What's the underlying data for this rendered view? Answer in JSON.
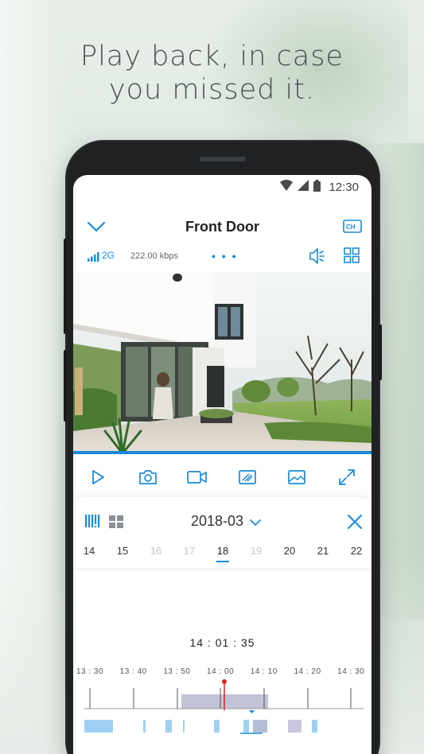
{
  "headline": {
    "line1": "Play back, in case",
    "line2": "you missed it."
  },
  "statusbar": {
    "time": "12:30",
    "icons": [
      "wifi-icon",
      "cell-signal-icon",
      "battery-icon"
    ]
  },
  "appbar": {
    "title": "Front Door",
    "back_icon": "chevron-down-icon",
    "channel_button_label": "CH"
  },
  "infobar": {
    "network": "2G",
    "bitrate": "222.00 kbps",
    "more": "• • •"
  },
  "toolbar": {
    "items": [
      "play-icon",
      "camera-icon",
      "video-record-icon",
      "hd-icon",
      "image-icon",
      "fullscreen-icon"
    ]
  },
  "playback": {
    "month": "2018-03",
    "days": [
      {
        "label": "14",
        "state": "normal"
      },
      {
        "label": "15",
        "state": "normal"
      },
      {
        "label": "16",
        "state": "faded"
      },
      {
        "label": "17",
        "state": "faded"
      },
      {
        "label": "18",
        "state": "active"
      },
      {
        "label": "19",
        "state": "faded"
      },
      {
        "label": "20",
        "state": "normal"
      },
      {
        "label": "21",
        "state": "normal"
      },
      {
        "label": "22",
        "state": "normal"
      }
    ],
    "current_time": "14 : 01 : 35",
    "timeline_labels": [
      "13 : 30",
      "13 : 40",
      "13 : 50",
      "14 : 00",
      "14 : 10",
      "14 : 20",
      "14 : 30"
    ]
  },
  "colors": {
    "accent": "#1a8bd8",
    "playhead": "#e02020",
    "segment": "#9fd0f3",
    "selection": "#b7b8cc"
  }
}
